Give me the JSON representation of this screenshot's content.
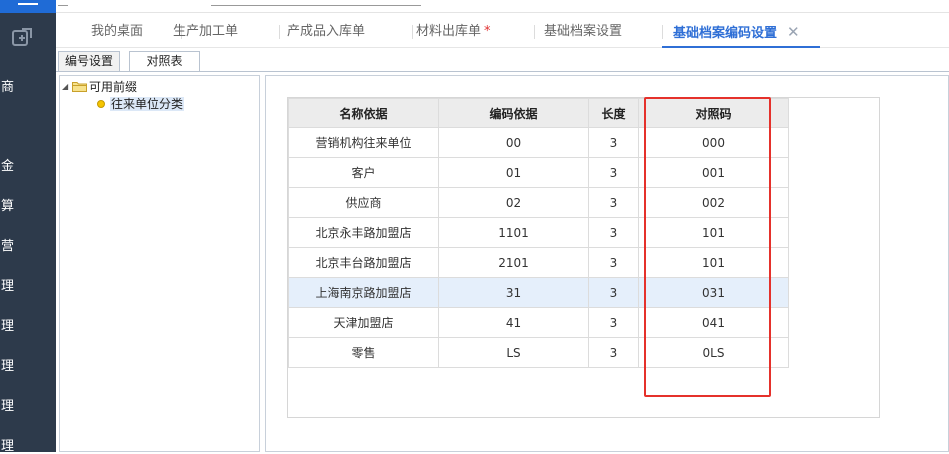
{
  "sidebar": {
    "nav_items": [
      "商",
      "金",
      "算",
      "营",
      "理",
      "理",
      "理",
      "理",
      "理"
    ]
  },
  "tabs": [
    {
      "label": "我的桌面"
    },
    {
      "label": "生产加工单"
    },
    {
      "label": "产成品入库单"
    },
    {
      "label": "材料出库单",
      "dirty": "*"
    },
    {
      "label": "基础档案设置"
    },
    {
      "label": "基础档案编码设置",
      "close": "✕"
    }
  ],
  "subtabs": [
    {
      "label": "编号设置"
    },
    {
      "label": "对照表"
    }
  ],
  "tree": {
    "root": {
      "toggle": "◢",
      "label": "可用前缀"
    },
    "child": {
      "label": "往来单位分类"
    }
  },
  "grid": {
    "columns": [
      "名称依据",
      "编码依据",
      "长度",
      "对照码"
    ],
    "rows": [
      [
        "营销机构往来单位",
        "00",
        "3",
        "000"
      ],
      [
        "客户",
        "01",
        "3",
        "001"
      ],
      [
        "供应商",
        "02",
        "3",
        "002"
      ],
      [
        "北京永丰路加盟店",
        "1101",
        "3",
        "101"
      ],
      [
        "北京丰台路加盟店",
        "2101",
        "3",
        "101"
      ],
      [
        "上海南京路加盟店",
        "31",
        "3",
        "031"
      ],
      [
        "天津加盟店",
        "41",
        "3",
        "041"
      ],
      [
        "零售",
        "LS",
        "3",
        "0LS"
      ]
    ],
    "highlighted_row": 5
  },
  "colors": {
    "accent": "#2f6fd6",
    "sidebar_bg": "#2d3a4b",
    "annotation_red": "#e5312b",
    "row_highlight": "#e5effb"
  }
}
